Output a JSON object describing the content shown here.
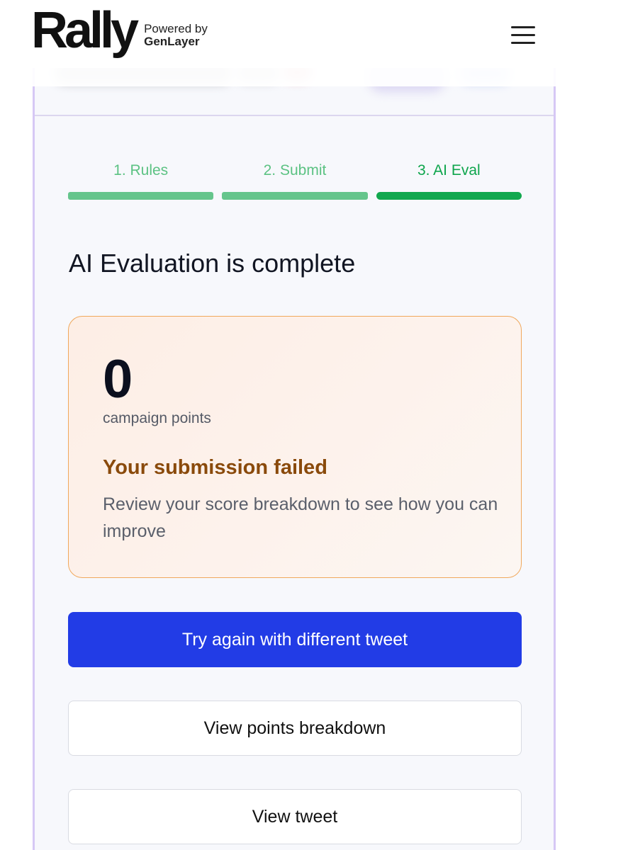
{
  "header": {
    "logo_text": "Rally",
    "powered_line1": "Powered by",
    "powered_line2": "GenLayer",
    "menu_icon": "hamburger-menu-icon"
  },
  "steps": [
    {
      "label": "1. Rules",
      "state": "done"
    },
    {
      "label": "2. Submit",
      "state": "done"
    },
    {
      "label": "3. AI Eval",
      "state": "active"
    }
  ],
  "evaluation": {
    "title": "AI Evaluation is complete",
    "score": "0",
    "score_unit": "campaign points",
    "status_title": "Your submission failed",
    "status_description": "Review your score breakdown to see how you can improve"
  },
  "actions": {
    "try_again": "Try again with different tweet",
    "view_breakdown": "View points breakdown",
    "view_tweet": "View tweet"
  },
  "colors": {
    "primary_button": "#223ce6",
    "step_done": "#65c58c",
    "step_active": "#12a84f",
    "fail_text": "#8a4a0b",
    "result_border": "#f0a85c",
    "frame": "#d6c8f5"
  }
}
